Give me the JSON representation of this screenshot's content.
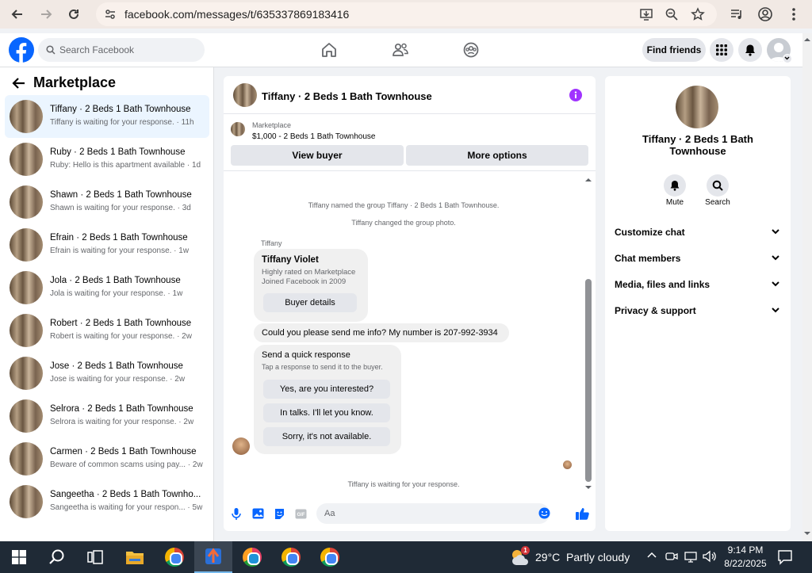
{
  "browser": {
    "url": "facebook.com/messages/t/635337869183416",
    "icons": [
      "back-icon",
      "forward-icon",
      "reload-icon",
      "site-info-icon",
      "install-app-icon",
      "zoom-icon",
      "bookmark-star-icon",
      "media-icon",
      "profile-icon",
      "menu-icon"
    ]
  },
  "header": {
    "search_placeholder": "Search Facebook",
    "find_friends": "Find friends",
    "brand_color": "#0866ff"
  },
  "sidebar": {
    "title": "Marketplace",
    "conversations": [
      {
        "name": "Tiffany · 2 Beds 1 Bath Townhouse",
        "preview": "Tiffany is waiting for your response. · 11h",
        "active": true
      },
      {
        "name": "Ruby · 2 Beds 1 Bath Townhouse",
        "preview": "Ruby: Hello is this apartment available · 1d"
      },
      {
        "name": "Shawn · 2 Beds 1 Bath Townhouse",
        "preview": "Shawn is waiting for your response. · 3d"
      },
      {
        "name": "Efrain · 2 Beds 1 Bath Townhouse",
        "preview": "Efrain is waiting for your response. · 1w"
      },
      {
        "name": "Jola · 2 Beds 1 Bath Townhouse",
        "preview": "Jola is waiting for your response. · 1w"
      },
      {
        "name": "Robert · 2 Beds 1 Bath Townhouse",
        "preview": "Robert is waiting for your response. · 2w"
      },
      {
        "name": "Jose · 2 Beds 1 Bath Townhouse",
        "preview": "Jose is waiting for your response. · 2w"
      },
      {
        "name": "Selrora · 2 Beds 1 Bath Townhouse",
        "preview": "Selrora is waiting for your response. · 2w"
      },
      {
        "name": "Carmen · 2 Beds 1 Bath Townhouse",
        "preview": "Beware of common scams using pay... · 2w"
      },
      {
        "name": "Sangeetha · 2 Beds 1 Bath Townho...",
        "preview": "Sangeetha is waiting for your respon... · 5w"
      }
    ]
  },
  "chat": {
    "title": "Tiffany · 2 Beds 1 Bath Townhouse",
    "listing_source": "Marketplace",
    "listing_detail": "$1,000 - 2 Beds 1 Bath Townhouse",
    "view_buyer": "View buyer",
    "more_options": "More options",
    "system_messages": [
      "Tiffany named the group Tiffany · 2 Beds 1 Bath Townhouse.",
      "Tiffany changed the group photo."
    ],
    "sender_label": "Tiffany",
    "buyer_card": {
      "name": "Tiffany Violet",
      "line1": "Highly rated on Marketplace",
      "line2": "Joined Facebook in 2009",
      "button": "Buyer details"
    },
    "message": "Could you please send me info?  My number is 207-992-3934",
    "quick_response": {
      "title": "Send a quick response",
      "subtitle": "Tap a response to send it to the buyer.",
      "options": [
        "Yes, are you interested?",
        "In talks. I'll let you know.",
        "Sorry, it's not available."
      ]
    },
    "waiting": "Tiffany is waiting for your response.",
    "composer_placeholder": "Aa",
    "accent_color": "#a033ff"
  },
  "details": {
    "name": "Tiffany · 2 Beds 1 Bath Townhouse",
    "actions": [
      {
        "label": "Mute",
        "icon": "bell-icon"
      },
      {
        "label": "Search",
        "icon": "search-icon"
      }
    ],
    "sections": [
      "Customize chat",
      "Chat members",
      "Media, files and links",
      "Privacy & support"
    ]
  },
  "taskbar": {
    "weather": "29°C  Partly cloudy",
    "time": "9:14 PM",
    "date": "8/22/2025",
    "notification_badge": "1"
  }
}
